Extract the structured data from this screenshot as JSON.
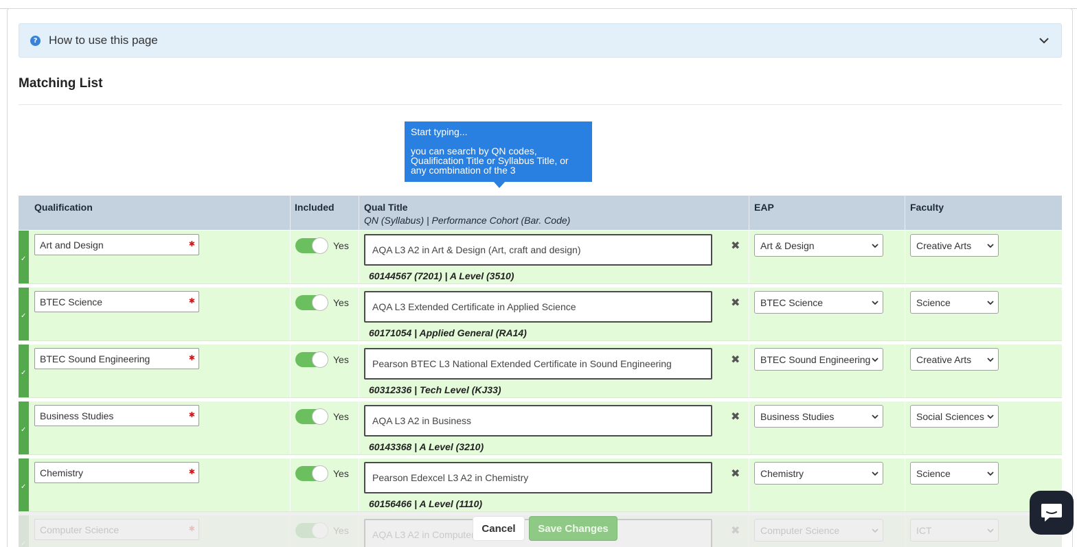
{
  "howto": {
    "label": "How to use this page"
  },
  "section": {
    "title": "Matching List"
  },
  "tooltip": {
    "line1": "Start typing...",
    "line2": "you can search by QN codes, Qualification Title or Syllabus Title, or any combination of the 3"
  },
  "table": {
    "headers": {
      "qualification": "Qualification",
      "included": "Included",
      "qual_title": "Qual Title",
      "qual_title_sub": "QN (Syllabus) | Performance Cohort (Bar. Code)",
      "eap": "EAP",
      "faculty": "Faculty"
    },
    "rows": [
      {
        "qualification": "Art and Design",
        "included": "Yes",
        "qual_title": "AQA L3 A2 in Art & Design (Art, craft and design)",
        "qual_sub": "60144567 (7201) | A Level (3510)",
        "eap": "Art & Design",
        "faculty": "Creative Arts"
      },
      {
        "qualification": "BTEC Science",
        "included": "Yes",
        "qual_title": "AQA L3 Extended Certificate in Applied Science",
        "qual_sub": "60171054 | Applied General (RA14)",
        "eap": "BTEC Science",
        "faculty": "Science"
      },
      {
        "qualification": "BTEC Sound Engineering",
        "included": "Yes",
        "qual_title": "Pearson BTEC L3 National Extended Certificate in Sound Engineering",
        "qual_sub": "60312336 | Tech Level (KJ33)",
        "eap": "BTEC Sound Engineering",
        "faculty": "Creative Arts"
      },
      {
        "qualification": "Business Studies",
        "included": "Yes",
        "qual_title": "AQA L3 A2 in Business",
        "qual_sub": "60143368 | A Level (3210)",
        "eap": "Business Studies",
        "faculty": "Social Sciences"
      },
      {
        "qualification": "Chemistry",
        "included": "Yes",
        "qual_title": "Pearson Edexcel L3 A2 in Chemistry",
        "qual_sub": "60156466 | A Level (1110)",
        "eap": "Chemistry",
        "faculty": "Science"
      },
      {
        "qualification": "Computer Science",
        "included": "Yes",
        "qual_title": "AQA L3 A2 in Computer",
        "qual_sub": "",
        "eap": "Computer Science",
        "faculty": "ICT"
      }
    ]
  },
  "actions": {
    "cancel": "Cancel",
    "save": "Save Changes"
  },
  "colors": {
    "row_bg": "#e3fbd9",
    "row_marker": "#54a94c",
    "header_bg": "#c3d2de",
    "tooltip_bg": "#2a80e0",
    "toggle_on": "#6bbf5e",
    "save_btn": "#8ec986"
  },
  "icons": {
    "help": "question-circle-icon",
    "collapse": "chevron-down-icon",
    "remove": "close-x-icon",
    "row_status": "check-icon",
    "chat": "chat-bubble-icon"
  }
}
